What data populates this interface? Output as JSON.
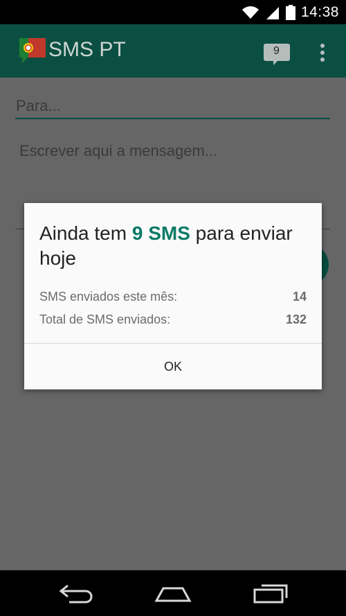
{
  "status_bar": {
    "time": "14:38"
  },
  "app_bar": {
    "title": "SMS PT",
    "badge_count": "9"
  },
  "compose": {
    "to_placeholder": "Para...",
    "message_placeholder": "Escrever aqui a mensagem..."
  },
  "dialog": {
    "title_prefix": "Ainda tem ",
    "title_highlight": "9 SMS",
    "title_suffix": " para enviar hoje",
    "stats": [
      {
        "label": "SMS enviados este mês:",
        "value": "14"
      },
      {
        "label": "Total de SMS enviados:",
        "value": "132"
      }
    ],
    "ok_label": "OK"
  },
  "icons": {
    "status": [
      "wifi-icon",
      "signal-icon",
      "battery-icon"
    ],
    "app_bar": [
      "portugal-flag-logo",
      "message-badge-icon",
      "overflow-menu-icon"
    ],
    "nav": [
      "back-icon",
      "home-icon",
      "recents-icon"
    ]
  },
  "colors": {
    "app_bar": "#0b4f43",
    "accent": "#0b7a66",
    "scrim": "#666666"
  }
}
